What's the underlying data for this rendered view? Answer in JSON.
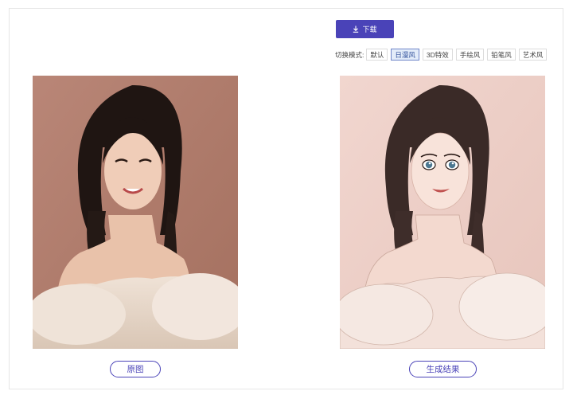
{
  "toolbar": {
    "download_label": "下载"
  },
  "mode": {
    "label": "切换模式:",
    "options": [
      "默认",
      "日漫风",
      "3D特效",
      "手绘风",
      "铅笔风",
      "艺术风"
    ],
    "selected": "日漫风"
  },
  "images": {
    "original_button": "原图",
    "result_button": "生成结果"
  },
  "colors": {
    "accent": "#4a43b8",
    "selected_bg": "#e3ecf9",
    "selected_border": "#6f86c9"
  }
}
